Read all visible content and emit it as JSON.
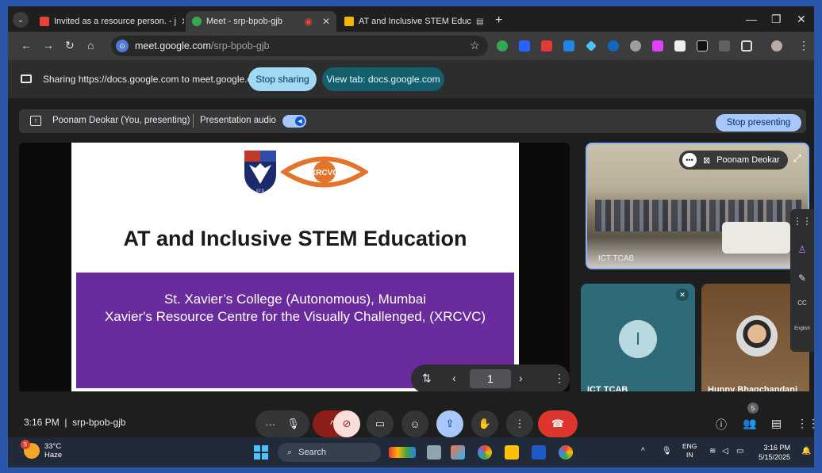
{
  "browser": {
    "tabs": [
      {
        "label": "Invited as a resource person. - j",
        "favicon_color": "#ea4335",
        "active": false
      },
      {
        "label": "Meet - srp-bpob-gjb",
        "favicon_color": "#34a853",
        "active": true
      },
      {
        "label": "AT and Inclusive STEM Educ",
        "favicon_color": "#f4b400",
        "active": false
      }
    ],
    "new_tab_label": "+",
    "url_host": "meet.google.com",
    "url_path": "/srp-bpob-gjb"
  },
  "share_bar": {
    "text": "Sharing https://docs.google.com to meet.google.com",
    "stop_sharing_label": "Stop sharing",
    "view_tab_label": "View tab: docs.google.com"
  },
  "presenter_bar": {
    "presenter": "Poonam Deokar (You, presenting)",
    "audio_label": "Presentation audio",
    "audio_on": true,
    "stop_presenting_label": "Stop presenting"
  },
  "slide": {
    "title": "AT and Inclusive STEM Education",
    "line1": "St. Xavier’s College (Autonomous), Mumbai",
    "line2": "Xavier's Resource Centre for the Visually Challenged, (XRCVC)",
    "logo_text": "XRCVC",
    "band_color": "#6a2c9c",
    "page_number": "1"
  },
  "participants": {
    "featured": {
      "name_chip": "Poonam Deokar",
      "label": "ICT TCAB"
    },
    "ict": {
      "name": "ICT TCAB",
      "initial": "I"
    },
    "hunny": {
      "name": "Hunny Bhagchandani"
    },
    "people_count": "5"
  },
  "side_rail": {
    "caption_lang": "English",
    "cc": "CC"
  },
  "meeting": {
    "time": "3:16 PM",
    "code": "srp-bpob-gjb"
  },
  "taskbar": {
    "temp": "33°C",
    "weather": "Haze",
    "weather_badge": "5",
    "search_label": "Search",
    "lang": "ENG",
    "region": "IN",
    "clock_time": "3:16 PM",
    "clock_date": "5/15/2025"
  }
}
